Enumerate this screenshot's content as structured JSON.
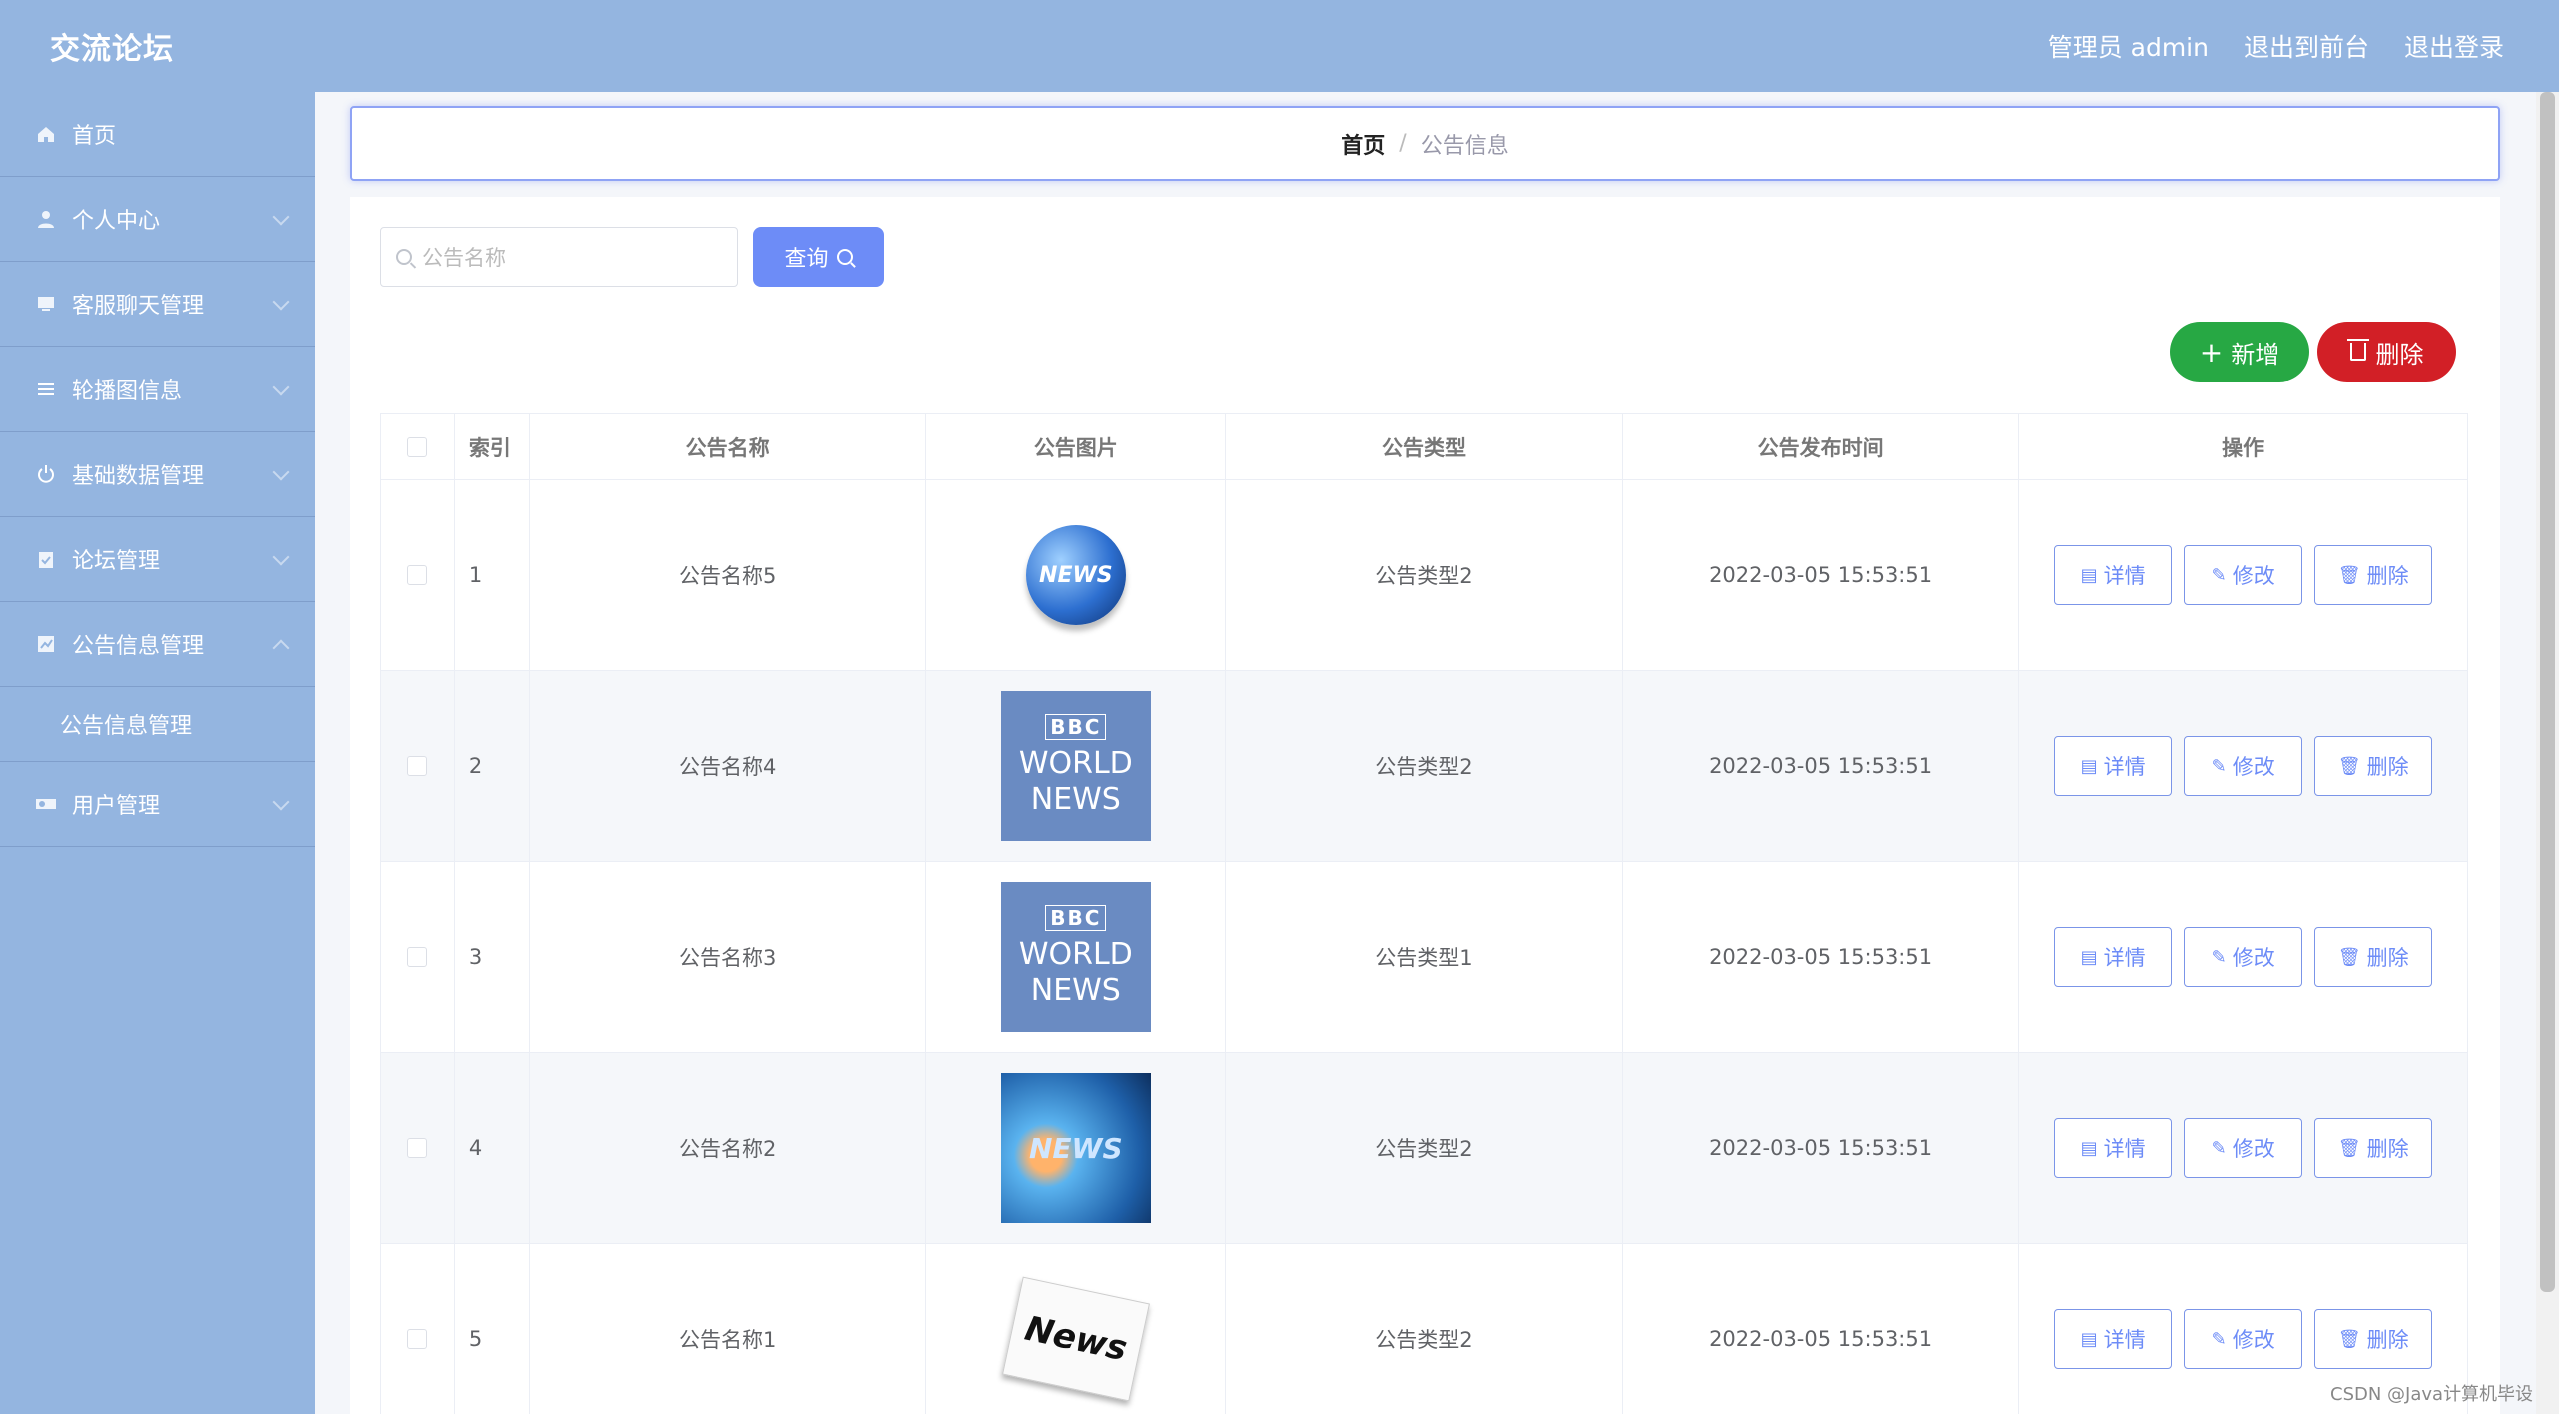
{
  "header": {
    "brand": "交流论坛",
    "admin": "管理员 admin",
    "to_front": "退出到前台",
    "logout": "退出登录"
  },
  "sidebar": {
    "items": [
      {
        "label": "首页",
        "icon": "home-icon"
      },
      {
        "label": "个人中心",
        "icon": "user-icon"
      },
      {
        "label": "客服聊天管理",
        "icon": "chat-icon"
      },
      {
        "label": "轮播图信息",
        "icon": "list-icon"
      },
      {
        "label": "基础数据管理",
        "icon": "power-icon"
      },
      {
        "label": "论坛管理",
        "icon": "clipboard-icon"
      },
      {
        "label": "公告信息管理",
        "icon": "chart-icon"
      }
    ],
    "sub_item": "公告信息管理",
    "last_item": {
      "label": "用户管理",
      "icon": "users-icon"
    }
  },
  "breadcrumb": {
    "home": "首页",
    "separator": "/",
    "current": "公告信息"
  },
  "search": {
    "placeholder": "公告名称",
    "query_label": "查询"
  },
  "actions": {
    "add_label": "新增",
    "delete_label": "删除"
  },
  "table": {
    "headers": [
      "索引",
      "公告名称",
      "公告图片",
      "公告类型",
      "公告发布时间",
      "操作"
    ],
    "rows": [
      {
        "index": "1",
        "name": "公告名称5",
        "image": "news-globe",
        "type": "公告类型2",
        "time": "2022-03-05 15:53:51"
      },
      {
        "index": "2",
        "name": "公告名称4",
        "image": "bbc-world-news",
        "type": "公告类型2",
        "time": "2022-03-05 15:53:51"
      },
      {
        "index": "3",
        "name": "公告名称3",
        "image": "bbc-world-news",
        "type": "公告类型1",
        "time": "2022-03-05 15:53:51"
      },
      {
        "index": "4",
        "name": "公告名称2",
        "image": "news-swirl",
        "type": "公告类型2",
        "time": "2022-03-05 15:53:51"
      },
      {
        "index": "5",
        "name": "公告名称1",
        "image": "news-paper",
        "type": "公告类型2",
        "time": "2022-03-05 15:53:51"
      }
    ],
    "row_actions": {
      "detail": "详情",
      "edit": "修改",
      "delete": "删除"
    }
  },
  "images": {
    "globe_text": "NEWS",
    "bbc_logo": "BBC",
    "bbc_line1": "WORLD",
    "bbc_line2": "NEWS",
    "swirl_text": "NEWS",
    "paper_text": "News"
  },
  "watermark": "CSDN @Java计算机毕设",
  "colors": {
    "header_bg": "#94b5e0",
    "primary": "#6d8cf7",
    "success": "#27a844",
    "danger": "#d21f26"
  }
}
